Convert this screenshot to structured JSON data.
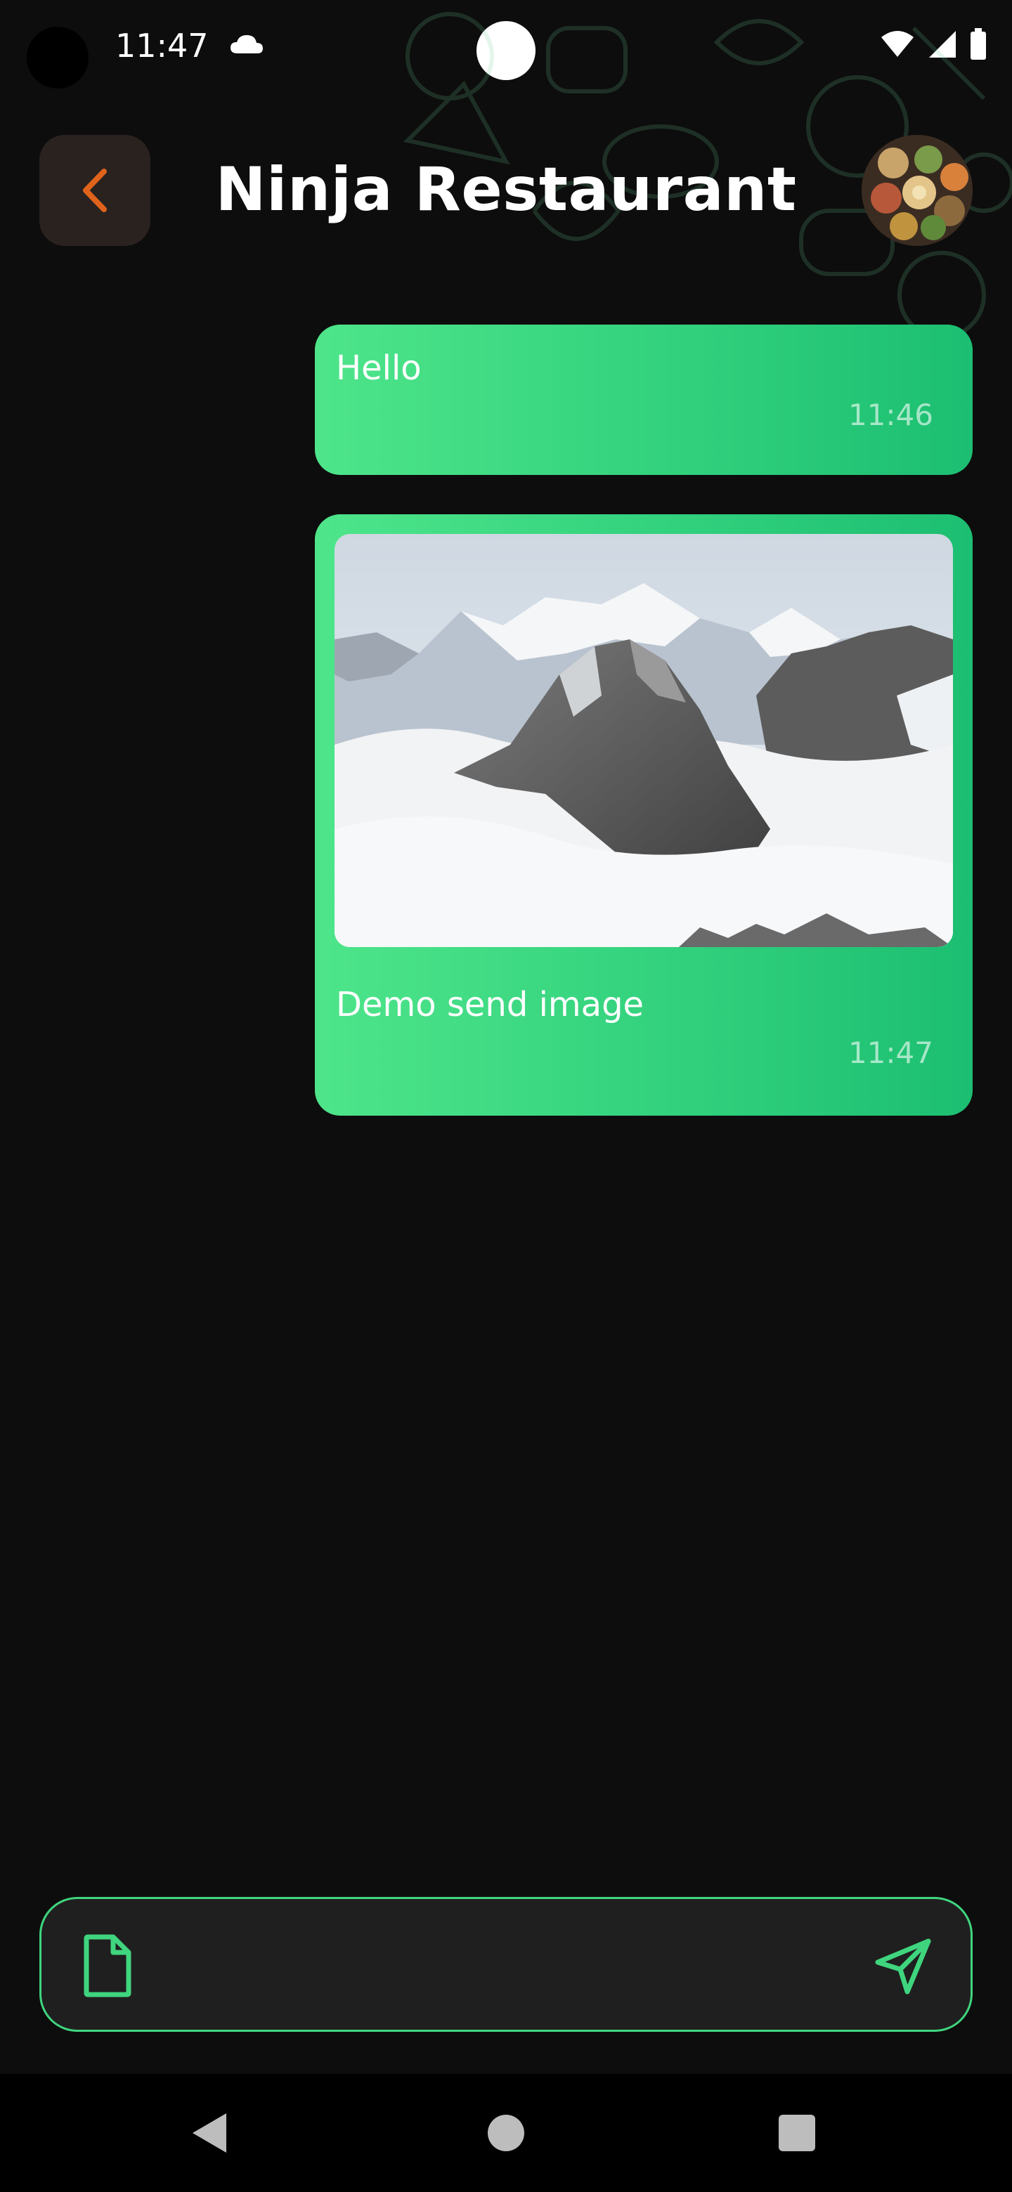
{
  "status_bar": {
    "time": "11:47"
  },
  "header": {
    "title": "Ninja Restaurant"
  },
  "messages": [
    {
      "text": "Hello",
      "time": "11:46"
    },
    {
      "text": "Demo send image",
      "time": "11:47"
    }
  ],
  "composer": {
    "placeholder": "",
    "value": ""
  },
  "colors": {
    "background": "#0d0d0d",
    "bubble_start": "#4ee58a",
    "bubble_end": "#1cbe71",
    "accent_orange": "#e0631c",
    "composer_border": "#3fd57e"
  },
  "icons": [
    "cloud-icon",
    "wifi-icon",
    "signal-icon",
    "battery-icon",
    "back-arrow-icon",
    "file-icon",
    "send-icon"
  ]
}
